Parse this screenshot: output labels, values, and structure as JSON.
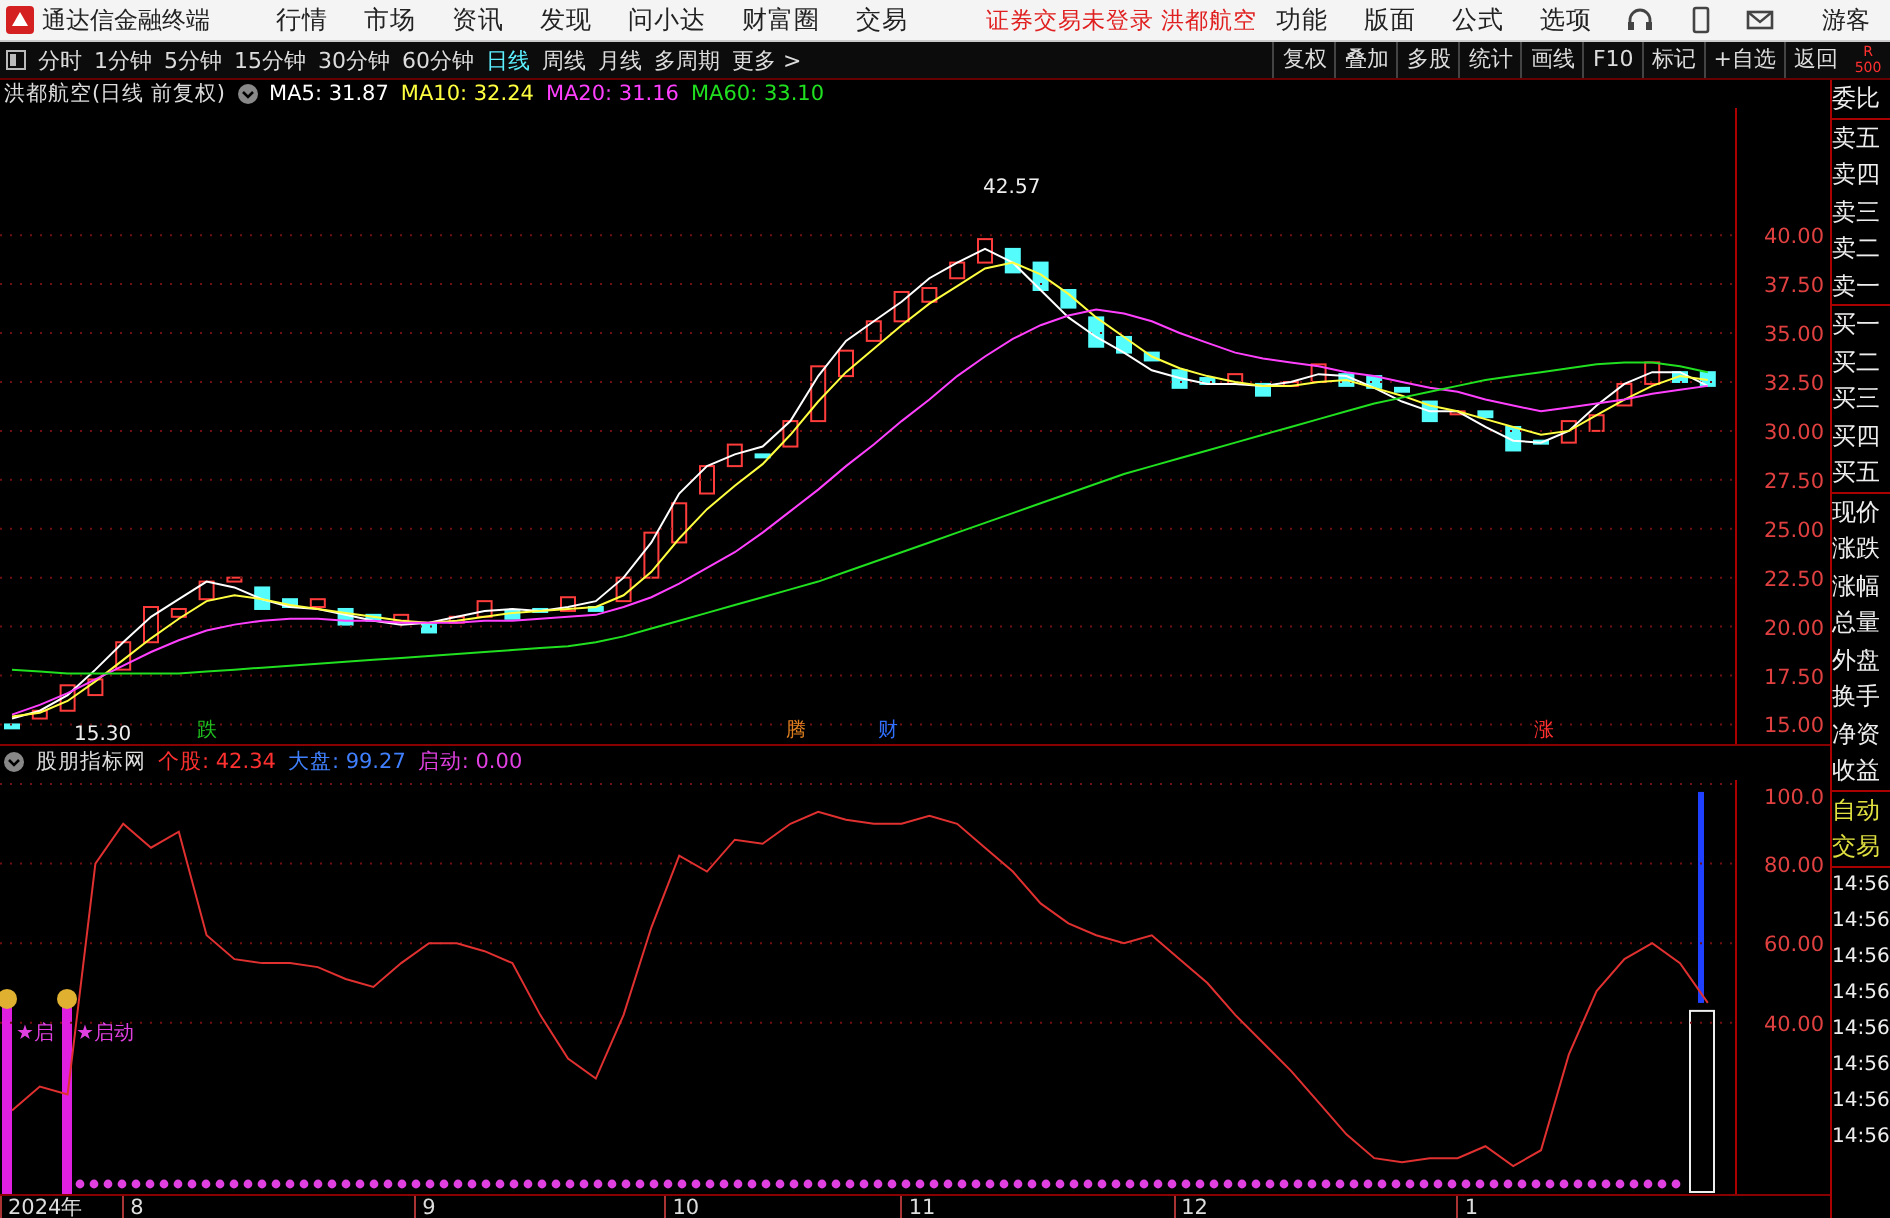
{
  "title_bar": {
    "app_name": "通达信金融终端",
    "menu": [
      "行情",
      "市场",
      "资讯",
      "发现",
      "问小达",
      "财富圈",
      "交易"
    ],
    "notice": "证券交易未登录 洪都航空",
    "right_menu": [
      "功能",
      "版面",
      "公式",
      "选项"
    ],
    "user": "游客"
  },
  "toolbar": {
    "periods": [
      {
        "label": "分时",
        "selected": false
      },
      {
        "label": "1分钟",
        "selected": false
      },
      {
        "label": "5分钟",
        "selected": false
      },
      {
        "label": "15分钟",
        "selected": false
      },
      {
        "label": "30分钟",
        "selected": false
      },
      {
        "label": "60分钟",
        "selected": false
      },
      {
        "label": "日线",
        "selected": true
      },
      {
        "label": "周线",
        "selected": false
      },
      {
        "label": "月线",
        "selected": false
      },
      {
        "label": "多周期",
        "selected": false
      },
      {
        "label": "更多 >",
        "selected": false
      }
    ],
    "actions": [
      "复权",
      "叠加",
      "多股",
      "统计",
      "画线",
      "F10",
      "标记",
      "+自选",
      "返回"
    ],
    "corner": [
      "R",
      "500"
    ]
  },
  "price_panel": {
    "title": "洪都航空(日线 前复权)",
    "ma_legend": [
      {
        "text": "MA5: 31.87",
        "color": "#ffffff"
      },
      {
        "text": "MA10: 32.24",
        "color": "#ffff40"
      },
      {
        "text": "MA20: 31.16",
        "color": "#ff40ff"
      },
      {
        "text": "MA60: 33.10",
        "color": "#20e020"
      }
    ],
    "chart_data": {
      "type": "line",
      "grid": true,
      "ylim": [
        14,
        46.5
      ],
      "yticks": [
        {
          "value": 15,
          "label": "15.00"
        },
        {
          "value": 17.5,
          "label": "17.50"
        },
        {
          "value": 20,
          "label": "20.00"
        },
        {
          "value": 22.5,
          "label": "22.50"
        },
        {
          "value": 25,
          "label": "25.00"
        },
        {
          "value": 27.5,
          "label": "27.50"
        },
        {
          "value": 30,
          "label": "30.00"
        },
        {
          "value": 32.5,
          "label": "32.50"
        },
        {
          "value": 35,
          "label": "35.00"
        },
        {
          "value": 37.5,
          "label": "37.50"
        },
        {
          "value": 40,
          "label": "40.00"
        }
      ],
      "series": [
        {
          "color": "#ffffff",
          "values": [
            15.3,
            15.7,
            16.5,
            17.8,
            19.2,
            20.5,
            21.4,
            22.3,
            22.0,
            21.4,
            21.0,
            20.9,
            20.6,
            20.3,
            20.1,
            20.2,
            20.5,
            20.8,
            20.9,
            20.8,
            21.0,
            21.3,
            22.5,
            24.3,
            26.8,
            28.2,
            28.8,
            29.2,
            30.5,
            32.8,
            34.6,
            35.6,
            36.6,
            37.8,
            38.6,
            39.3,
            38.6,
            37.2,
            35.8,
            34.8,
            34.0,
            33.1,
            32.7,
            32.4,
            32.4,
            32.3,
            32.5,
            32.9,
            32.8,
            32.2,
            31.5,
            31.0,
            31.0,
            30.2,
            29.5,
            29.4,
            30.0,
            31.3,
            32.4,
            33.0,
            33.0,
            32.3
          ]
        },
        {
          "color": "#ffff40",
          "values": [
            15.4,
            15.6,
            16.2,
            17.2,
            18.3,
            19.4,
            20.4,
            21.3,
            21.6,
            21.4,
            21.1,
            20.9,
            20.7,
            20.5,
            20.3,
            20.2,
            20.3,
            20.5,
            20.7,
            20.8,
            20.9,
            21.0,
            21.6,
            22.8,
            24.5,
            26.0,
            27.2,
            28.3,
            29.8,
            31.5,
            33.0,
            34.2,
            35.4,
            36.5,
            37.4,
            38.3,
            38.6,
            38.0,
            37.0,
            35.8,
            34.8,
            33.8,
            33.2,
            32.8,
            32.5,
            32.3,
            32.3,
            32.5,
            32.6,
            32.2,
            31.8,
            31.3,
            31.0,
            30.6,
            30.2,
            29.8,
            30.0,
            30.8,
            31.6,
            32.3,
            32.8,
            32.6
          ]
        },
        {
          "color": "#ff40ff",
          "values": [
            15.5,
            16.0,
            16.6,
            17.3,
            18.0,
            18.7,
            19.3,
            19.8,
            20.1,
            20.3,
            20.4,
            20.4,
            20.3,
            20.3,
            20.2,
            20.2,
            20.2,
            20.3,
            20.3,
            20.4,
            20.5,
            20.6,
            21.0,
            21.5,
            22.2,
            23.0,
            23.8,
            24.8,
            25.9,
            27.0,
            28.2,
            29.3,
            30.5,
            31.6,
            32.8,
            33.8,
            34.7,
            35.4,
            35.9,
            36.2,
            36.0,
            35.6,
            35.0,
            34.5,
            34.0,
            33.7,
            33.5,
            33.3,
            33.0,
            32.8,
            32.5,
            32.2,
            32.0,
            31.6,
            31.3,
            31.0,
            31.2,
            31.4,
            31.6,
            31.9,
            32.1,
            32.3
          ]
        },
        {
          "color": "#20e020",
          "values": [
            17.8,
            17.7,
            17.6,
            17.6,
            17.6,
            17.6,
            17.6,
            17.7,
            17.8,
            17.9,
            18.0,
            18.1,
            18.2,
            18.3,
            18.4,
            18.5,
            18.6,
            18.7,
            18.8,
            18.9,
            19.0,
            19.2,
            19.5,
            19.9,
            20.3,
            20.7,
            21.1,
            21.5,
            21.9,
            22.3,
            22.8,
            23.3,
            23.8,
            24.3,
            24.8,
            25.3,
            25.8,
            26.3,
            26.8,
            27.3,
            27.8,
            28.2,
            28.6,
            29.0,
            29.4,
            29.8,
            30.2,
            30.6,
            31.0,
            31.4,
            31.7,
            32.0,
            32.3,
            32.6,
            32.8,
            33.0,
            33.2,
            33.4,
            33.5,
            33.5,
            33.3,
            33.0
          ]
        }
      ],
      "annotations": [
        {
          "text": "42.57"
        },
        {
          "text": "15.30"
        }
      ]
    },
    "signals": [
      {
        "text": "跌",
        "color": "#20c020"
      },
      {
        "text": "腾",
        "color": "#e08020"
      },
      {
        "text": "财",
        "color": "#3070ff"
      },
      {
        "text": "涨",
        "color": "#ff3030"
      }
    ]
  },
  "indicator_panel": {
    "title": "股朋指标网",
    "legend": [
      {
        "text": "个股: 42.34",
        "color": "#ff3030"
      },
      {
        "text": "大盘: 99.27",
        "color": "#4080ff"
      },
      {
        "text": "启动: 0.00",
        "color": "#e040e0"
      }
    ],
    "chart_data": {
      "type": "line",
      "grid": true,
      "ylim": [
        -3,
        101
      ],
      "yticks": [
        {
          "value": 40,
          "label": "40.00"
        },
        {
          "value": 60,
          "label": "60.00"
        },
        {
          "value": 80,
          "label": "80.00"
        },
        {
          "value": 100,
          "label": "100.0"
        }
      ],
      "series": [
        {
          "color": "#e03030",
          "values": [
            18,
            24,
            22,
            80,
            90,
            84,
            88,
            62,
            56,
            55,
            55,
            54,
            51,
            49,
            55,
            60,
            60,
            58,
            55,
            42,
            31,
            26,
            42,
            64,
            82,
            78,
            86,
            85,
            90,
            93,
            91,
            90,
            90,
            92,
            90,
            84,
            78,
            70,
            65,
            62,
            60,
            62,
            56,
            50,
            42,
            35,
            28,
            20,
            12,
            6,
            5,
            6,
            6,
            9,
            4,
            8,
            32,
            48,
            56,
            60,
            55,
            45
          ]
        }
      ]
    },
    "start_signals": [
      {
        "label": "★启"
      },
      {
        "label": "★启动"
      }
    ],
    "date_labels": [
      "2024年",
      "8",
      "9",
      "10",
      "11",
      "12",
      "1"
    ]
  },
  "side_panel": {
    "groups": [
      [
        "委比"
      ],
      [
        "卖五",
        "卖四",
        "卖三",
        "卖二",
        "卖一"
      ],
      [
        "买一",
        "买二",
        "买三",
        "买四",
        "买五"
      ],
      [
        "现价",
        "涨跌",
        "涨幅",
        "总量",
        "外盘",
        "换手",
        "净资",
        "收益"
      ],
      [
        "自动",
        "交易"
      ]
    ],
    "times": [
      "14:56",
      "14:56",
      "14:56",
      "14:56",
      "14:56",
      "14:56",
      "14:56",
      "14:56"
    ]
  }
}
